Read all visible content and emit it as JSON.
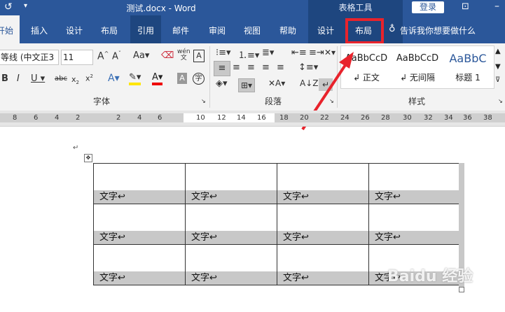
{
  "titlebar": {
    "title": "测试.docx  -  Word",
    "table_tools": "表格工具",
    "login": "登录"
  },
  "tabs": [
    {
      "label": "开始"
    },
    {
      "label": "插入"
    },
    {
      "label": "设计"
    },
    {
      "label": "布局"
    },
    {
      "label": "引用"
    },
    {
      "label": "邮件"
    },
    {
      "label": "审阅"
    },
    {
      "label": "视图"
    },
    {
      "label": "帮助"
    },
    {
      "label": "设计"
    },
    {
      "label": "布局"
    }
  ],
  "tell_me": "告诉我你想要做什么",
  "font": {
    "name": "等线 (中文正3",
    "size": "11",
    "group_label": "字体"
  },
  "paragraph": {
    "group_label": "段落"
  },
  "styles": {
    "group_label": "样式",
    "items": [
      {
        "sample": "AaBbCcD",
        "name": "↲ 正文"
      },
      {
        "sample": "AaBbCcD",
        "name": "↲ 无间隔"
      },
      {
        "sample": "AaBbC",
        "name": "标题 1"
      }
    ]
  },
  "ruler": [
    "8",
    "6",
    "4",
    "2",
    "2",
    "4",
    "6",
    "10",
    "12",
    "14",
    "16",
    "18",
    "20",
    "22",
    "24",
    "26",
    "28",
    "30",
    "32",
    "34",
    "36",
    "38"
  ],
  "table": {
    "rows": [
      [
        "文字↩",
        "文字↩",
        "文字↩",
        "文字↩"
      ],
      [
        "文字↩",
        "文字↩",
        "文字↩",
        "文字↩"
      ],
      [
        "文字↩",
        "文字↩",
        "文字↩",
        "文字↩"
      ]
    ]
  },
  "watermark": "Baidu 经验",
  "colors": {
    "ribbon_blue": "#2b579a",
    "context_blue": "#1e467f",
    "highlight_red": "#e8232c"
  }
}
